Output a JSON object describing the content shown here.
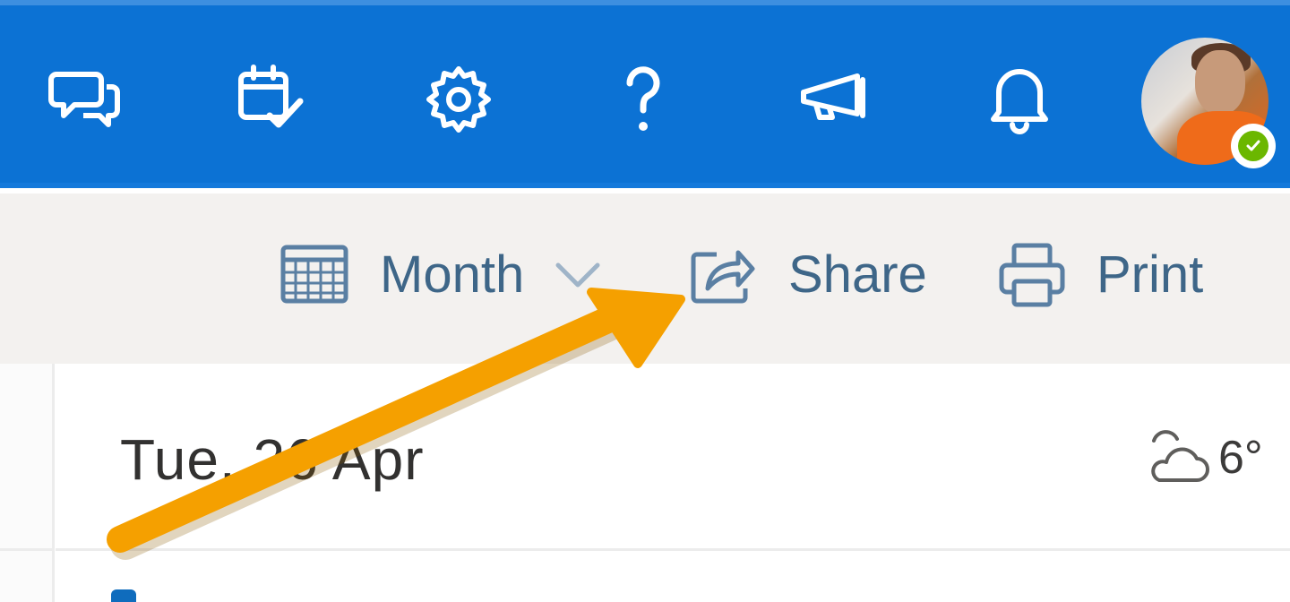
{
  "topbar": {
    "buttons": [
      {
        "name": "chat-icon"
      },
      {
        "name": "my-day-icon"
      },
      {
        "name": "settings-gear-icon"
      },
      {
        "name": "help-icon"
      },
      {
        "name": "whats-new-megaphone-icon"
      },
      {
        "name": "notifications-bell-icon"
      }
    ],
    "background_color": "#0c72d4",
    "presence_status_color": "#6bb700"
  },
  "commandbar": {
    "view_label": "Month",
    "share_label": "Share",
    "print_label": "Print"
  },
  "calendar": {
    "day_title": "Tue, 26 Apr",
    "weather_temp": "6°",
    "weather_icon": "partly-cloudy-icon"
  },
  "annotation": {
    "arrow_color": "#f5a000"
  }
}
